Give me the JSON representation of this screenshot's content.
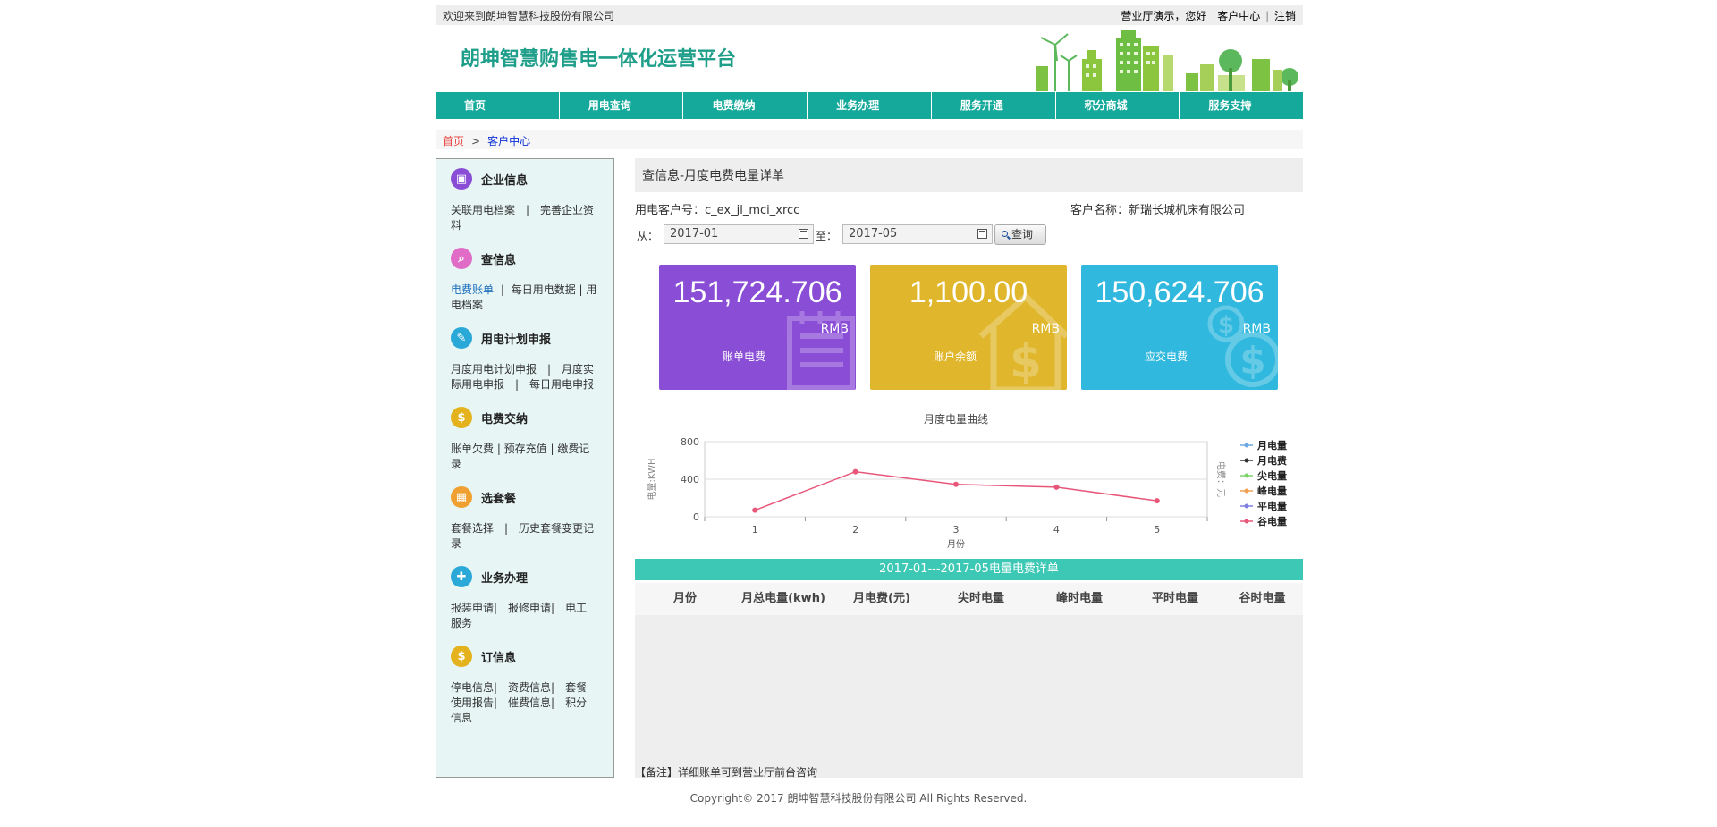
{
  "topbar": {
    "welcome": "欢迎来到朗坤智慧科技股份有限公司",
    "demo_greeting": "营业厅演示，您好",
    "customer_center": "客户中心",
    "divider": "|",
    "logout": "注销"
  },
  "header": {
    "brand": "朗坤智慧购售电一体化运营平台"
  },
  "nav": {
    "items": [
      "首页",
      "用电查询",
      "电费缴纳",
      "业务办理",
      "服务开通",
      "积分商城",
      "服务支持"
    ]
  },
  "breadcrumb": {
    "home": "首页",
    "sep": ">",
    "current": "客户中心"
  },
  "sidebar": {
    "sections": [
      {
        "title": "企业信息",
        "icon": "company-info-icon",
        "color": "#8a4dd6",
        "lines": [
          "关联用电档案　|　完善企业资",
          "料"
        ]
      },
      {
        "title": "查信息",
        "icon": "query-doc-icon",
        "color": "#e06cc8",
        "lines": [
          "每日用电数据 | 用",
          "电档案"
        ],
        "active": "电费账单",
        "active_sep": "|"
      },
      {
        "title": "用电计划申报",
        "icon": "plan-report-icon",
        "color": "#2aa9d8",
        "lines": [
          "月度用电计划申报　|　月度实",
          "际用电申报　|　每日用电申报"
        ]
      },
      {
        "title": "电费交纳",
        "icon": "dollar-icon",
        "color": "#e3b21c",
        "lines": [
          "账单欠费 | 预存充值 | 缴费记",
          "录"
        ]
      },
      {
        "title": "选套餐",
        "icon": "package-icon",
        "color": "#f0a030",
        "lines": [
          "套餐选择　|　历史套餐变更记",
          "录"
        ]
      },
      {
        "title": "业务办理",
        "icon": "business-icon",
        "color": "#2aa9d8",
        "lines": [
          "报装申请|　报修申请|　电工",
          "服务"
        ]
      },
      {
        "title": "订信息",
        "icon": "dollar-icon",
        "color": "#e3b21c",
        "lines": [
          "停电信息|　资费信息|　套餐",
          "使用报告|　催费信息|　积分",
          "信息"
        ]
      }
    ]
  },
  "main": {
    "title": "查信息-月度电费电量详单",
    "customer_no": "用电客户号：c_ex_jl_mci_xrcc",
    "customer_name": "客户名称：新瑞长城机床有限公司",
    "from_label": "从：",
    "from_value": "2017-01",
    "to_label": "至：",
    "to_value": "2017-05",
    "query_label": "查询"
  },
  "cards": [
    {
      "amount": "151,724.706",
      "unit": "RMB",
      "label": "账单电费",
      "color": "#8a4dd6",
      "icon": "notepad-icon"
    },
    {
      "amount": "1,100.00",
      "unit": "RMB",
      "label": "账户余额",
      "color": "#e0b72c",
      "icon": "house-dollar-icon"
    },
    {
      "amount": "150,624.706",
      "unit": "RMB",
      "label": "应交电费",
      "color": "#31b8de",
      "icon": "coins-icon"
    }
  ],
  "chart_data": {
    "type": "line",
    "title": "月度电量曲线",
    "xlabel": "月份",
    "ylabel": "电量:KWH",
    "y2label": "电费：元",
    "x": [
      1,
      2,
      3,
      4,
      5
    ],
    "ylim": [
      0,
      800
    ],
    "yticks": [
      0,
      400,
      800
    ],
    "grid": true,
    "legend_position": "right",
    "series": [
      {
        "name": "月电量",
        "color": "#6ea8e0",
        "values": []
      },
      {
        "name": "月电费",
        "color": "#333333",
        "values": []
      },
      {
        "name": "尖电量",
        "color": "#7ed36a",
        "values": []
      },
      {
        "name": "峰电量",
        "color": "#f0a050",
        "values": []
      },
      {
        "name": "平电量",
        "color": "#8080e0",
        "values": []
      },
      {
        "name": "谷电量",
        "color": "#e8567a",
        "values": [
          70,
          480,
          345,
          315,
          170
        ]
      }
    ]
  },
  "table": {
    "title": "2017-01---2017-05电量电费详单",
    "headers": [
      "月份",
      "月总电量(kwh)",
      "月电费(元)",
      "尖时电量",
      "峰时电量",
      "平时电量",
      "谷时电量"
    ],
    "note": "【备注】详细账单可到营业厅前台咨询"
  },
  "footer": {
    "copyright": "Copyright© 2017 朗坤智慧科技股份有限公司 All Rights Reserved."
  }
}
